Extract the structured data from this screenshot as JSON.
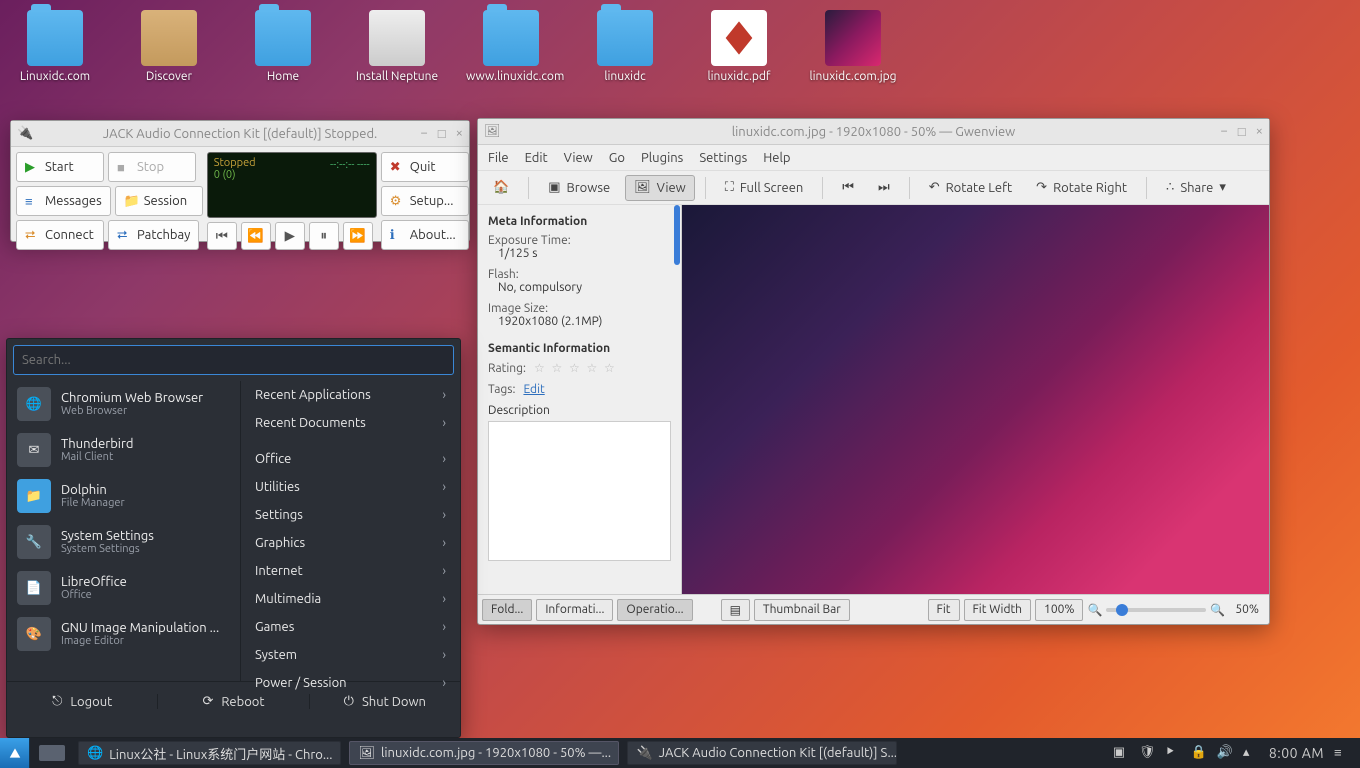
{
  "desktop": {
    "icons": [
      {
        "label": "Linuxidc.com",
        "type": "folder"
      },
      {
        "label": "Discover",
        "type": "box"
      },
      {
        "label": "Home",
        "type": "folder"
      },
      {
        "label": "Install Neptune",
        "type": "box"
      },
      {
        "label": "www.linuxidc.com",
        "type": "folder"
      },
      {
        "label": "linuxidc",
        "type": "folder"
      },
      {
        "label": "linuxidc.pdf",
        "type": "pdf"
      },
      {
        "label": "linuxidc.com.jpg",
        "type": "image"
      }
    ]
  },
  "jack": {
    "title": "JACK Audio Connection Kit [(default)] Stopped.",
    "buttons": {
      "start": "Start",
      "stop": "Stop",
      "messages": "Messages",
      "session": "Session",
      "connect": "Connect",
      "patchbay": "Patchbay",
      "quit": "Quit",
      "setup": "Setup...",
      "about": "About..."
    },
    "display": {
      "status": "Stopped",
      "rt": "0 (0)"
    }
  },
  "gwen": {
    "title": "linuxidc.com.jpg - 1920x1080 - 50% — Gwenview",
    "menu": [
      "File",
      "Edit",
      "View",
      "Go",
      "Plugins",
      "Settings",
      "Help"
    ],
    "toolbar": {
      "browse": "Browse",
      "view": "View",
      "fullscreen": "Full Screen",
      "rotl": "Rotate Left",
      "rotr": "Rotate Right",
      "share": "Share"
    },
    "meta": {
      "heading": "Meta Information",
      "exposure_k": "Exposure Time:",
      "exposure_v": "1/125 s",
      "flash_k": "Flash:",
      "flash_v": "No, compulsory",
      "size_k": "Image Size:",
      "size_v": "1920x1080 (2.1MP)"
    },
    "semantic": {
      "heading": "Semantic Information",
      "rating_k": "Rating:",
      "tags_k": "Tags:",
      "tags_link": "Edit",
      "desc_k": "Description"
    },
    "bottom": {
      "fold": "Fold...",
      "info": "Informati...",
      "ops": "Operatio...",
      "thumbbar": "Thumbnail Bar",
      "fit": "Fit",
      "fitw": "Fit Width",
      "hundred": "100%",
      "pct": "50%"
    }
  },
  "menu": {
    "search_placeholder": "Search...",
    "apps": [
      {
        "t": "Chromium Web Browser",
        "s": "Web Browser"
      },
      {
        "t": "Thunderbird",
        "s": "Mail Client"
      },
      {
        "t": "Dolphin",
        "s": "File Manager"
      },
      {
        "t": "System Settings",
        "s": "System Settings"
      },
      {
        "t": "LibreOffice",
        "s": "Office"
      },
      {
        "t": "GNU Image Manipulation ...",
        "s": "Image Editor"
      }
    ],
    "cats": [
      "Recent Applications",
      "Recent Documents",
      "Office",
      "Utilities",
      "Settings",
      "Graphics",
      "Internet",
      "Multimedia",
      "Games",
      "System",
      "Power / Session"
    ],
    "footer": {
      "logout": "Logout",
      "reboot": "Reboot",
      "shutdown": "Shut Down"
    }
  },
  "taskbar": {
    "items": [
      "Linux公社 - Linux系统门户网站 - Chro...",
      "linuxidc.com.jpg - 1920x1080 - 50%  —...",
      "JACK Audio Connection Kit [(default)] S..."
    ],
    "clock": "8:00 AM"
  }
}
